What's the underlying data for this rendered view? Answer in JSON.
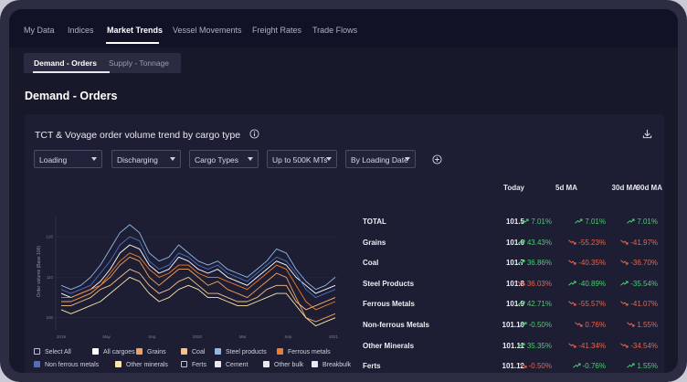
{
  "nav": {
    "tabs": [
      {
        "label": "My Data",
        "active": false
      },
      {
        "label": "Indices",
        "active": false
      },
      {
        "label": "Market Trends",
        "active": true
      },
      {
        "label": "Vessel Movements",
        "active": false
      },
      {
        "label": "Freight Rates",
        "active": false
      },
      {
        "label": "Trade Flows",
        "active": false
      }
    ]
  },
  "subtabs": [
    {
      "label": "Demand - Orders",
      "active": true
    },
    {
      "label": "Supply - Tonnage",
      "active": false
    }
  ],
  "page_title": "Demand - Orders",
  "card": {
    "title": "TCT & Voyage order volume trend by cargo type",
    "filters": [
      {
        "label": "Loading"
      },
      {
        "label": "Discharging"
      },
      {
        "label": "Cargo Types"
      },
      {
        "label": "Up to 500K MTs"
      },
      {
        "label": "By Loading Date"
      }
    ]
  },
  "table": {
    "headers": {
      "today": "Today",
      "ma5": "5d MA",
      "ma30": "30d MA",
      "ma90": "90d MA"
    },
    "rows": [
      {
        "name": "TOTAL",
        "today": "101.5",
        "ma5": "7.01%",
        "ma5_dir": "up",
        "ma30": "7.01%",
        "ma30_dir": "up",
        "ma90": "7.01%",
        "ma90_dir": "up"
      },
      {
        "name": "Grains",
        "today": "101.6",
        "ma5": "43.43%",
        "ma5_dir": "up",
        "ma30": "-55.23%",
        "ma30_dir": "down",
        "ma90": "-41.97%",
        "ma90_dir": "down"
      },
      {
        "name": "Coal",
        "today": "101.7",
        "ma5": "36.86%",
        "ma5_dir": "up",
        "ma30": "-40.35%",
        "ma30_dir": "down",
        "ma90": "-36.70%",
        "ma90_dir": "down"
      },
      {
        "name": "Steel Products",
        "today": "101.8",
        "ma5": "36.03%",
        "ma5_dir": "down",
        "ma30": "-40.89%",
        "ma30_dir": "up",
        "ma90": "-35.54%",
        "ma90_dir": "up"
      },
      {
        "name": "Ferrous Metals",
        "today": "101.9",
        "ma5": "42.71%",
        "ma5_dir": "up",
        "ma30": "-55.57%",
        "ma30_dir": "down",
        "ma90": "-41.07%",
        "ma90_dir": "down"
      },
      {
        "name": "Non-ferrous Metals",
        "today": "101.10",
        "ma5": "-0.50%",
        "ma5_dir": "up",
        "ma30": "0.76%",
        "ma30_dir": "down",
        "ma90": "1.55%",
        "ma90_dir": "down"
      },
      {
        "name": "Other Minerals",
        "today": "101.11",
        "ma5": "35.35%",
        "ma5_dir": "up",
        "ma30": "-41.34%",
        "ma30_dir": "down",
        "ma90": "-34.54%",
        "ma90_dir": "down"
      },
      {
        "name": "Ferts",
        "today": "101.12",
        "ma5": "-0.50%",
        "ma5_dir": "down",
        "ma30": "-0.76%",
        "ma30_dir": "up",
        "ma90": "1.55%",
        "ma90_dir": "up"
      }
    ]
  },
  "legend": [
    {
      "label": "Select All",
      "color": "#1d1e33",
      "checkbox": true
    },
    {
      "label": "All cargoes",
      "color": "#ffffff"
    },
    {
      "label": "Grains",
      "color": "#f4a259"
    },
    {
      "label": "Coal",
      "color": "#f6c28b"
    },
    {
      "label": "Steel products",
      "color": "#8fb8e8"
    },
    {
      "label": "Ferrous metals",
      "color": "#f07b2d"
    },
    {
      "label": "Non ferrous metals",
      "color": "#4a6fc4"
    },
    {
      "label": "Other minerals",
      "color": "#fbe7a8"
    },
    {
      "label": "Ferts",
      "color": "#1d1e33"
    },
    {
      "label": "Cement",
      "color": "#e9e9ee"
    },
    {
      "label": "Other bulk",
      "color": "#e9e9ee"
    },
    {
      "label": "Breakbulk",
      "color": "#e9e9ee"
    }
  ],
  "chart_data": {
    "type": "line",
    "ylabel": "Order volume (Base 100)",
    "y_ticks": [
      "120",
      "110",
      "100"
    ],
    "x_ticks": [
      "2019",
      "May",
      "Sep",
      "2020",
      "Mar",
      "Sep",
      "2021"
    ],
    "ylim": [
      97,
      125
    ],
    "series": [
      {
        "name": "All cargoes",
        "color": "#ffffff",
        "values": [
          106,
          105,
          106,
          107,
          109,
          112,
          116,
          118,
          117,
          113,
          111,
          112,
          115,
          114,
          112,
          111,
          112,
          110,
          109,
          108,
          110,
          112,
          114,
          113,
          110,
          108,
          106,
          107,
          108
        ]
      },
      {
        "name": "Grains",
        "color": "#f4a259",
        "values": [
          104,
          104,
          105,
          106,
          108,
          110,
          113,
          115,
          114,
          110,
          108,
          110,
          112,
          112,
          110,
          108,
          109,
          107,
          106,
          105,
          107,
          109,
          111,
          110,
          105,
          100,
          99,
          100,
          101
        ]
      },
      {
        "name": "Coal",
        "color": "#f6c28b",
        "values": [
          103,
          103,
          104,
          105,
          107,
          108,
          110,
          112,
          111,
          108,
          106,
          107,
          109,
          110,
          108,
          106,
          106,
          105,
          104,
          104,
          105,
          107,
          108,
          108,
          104,
          102,
          103,
          104,
          105
        ]
      },
      {
        "name": "Steel products",
        "color": "#8fb8e8",
        "values": [
          108,
          107,
          108,
          110,
          113,
          117,
          121,
          123,
          121,
          116,
          114,
          115,
          118,
          116,
          114,
          113,
          114,
          112,
          111,
          110,
          112,
          114,
          117,
          116,
          112,
          109,
          107,
          108,
          110
        ]
      },
      {
        "name": "Ferrous metals",
        "color": "#f07b2d",
        "values": [
          105,
          105,
          106,
          107,
          108,
          111,
          114,
          116,
          115,
          112,
          110,
          111,
          113,
          113,
          111,
          110,
          110,
          109,
          108,
          107,
          109,
          111,
          113,
          112,
          108,
          104,
          102,
          103,
          104
        ]
      },
      {
        "name": "Non ferrous metals",
        "color": "#4a6fc4",
        "values": [
          107,
          106,
          107,
          108,
          111,
          114,
          118,
          120,
          119,
          114,
          112,
          113,
          116,
          115,
          113,
          112,
          113,
          111,
          110,
          109,
          111,
          113,
          115,
          114,
          111,
          107,
          105,
          106,
          107
        ]
      },
      {
        "name": "Other minerals",
        "color": "#fbe7a8",
        "values": [
          102,
          101,
          102,
          103,
          104,
          106,
          108,
          110,
          109,
          106,
          104,
          105,
          107,
          108,
          107,
          105,
          105,
          104,
          103,
          103,
          104,
          105,
          106,
          106,
          103,
          100,
          98,
          99,
          100
        ]
      }
    ]
  }
}
